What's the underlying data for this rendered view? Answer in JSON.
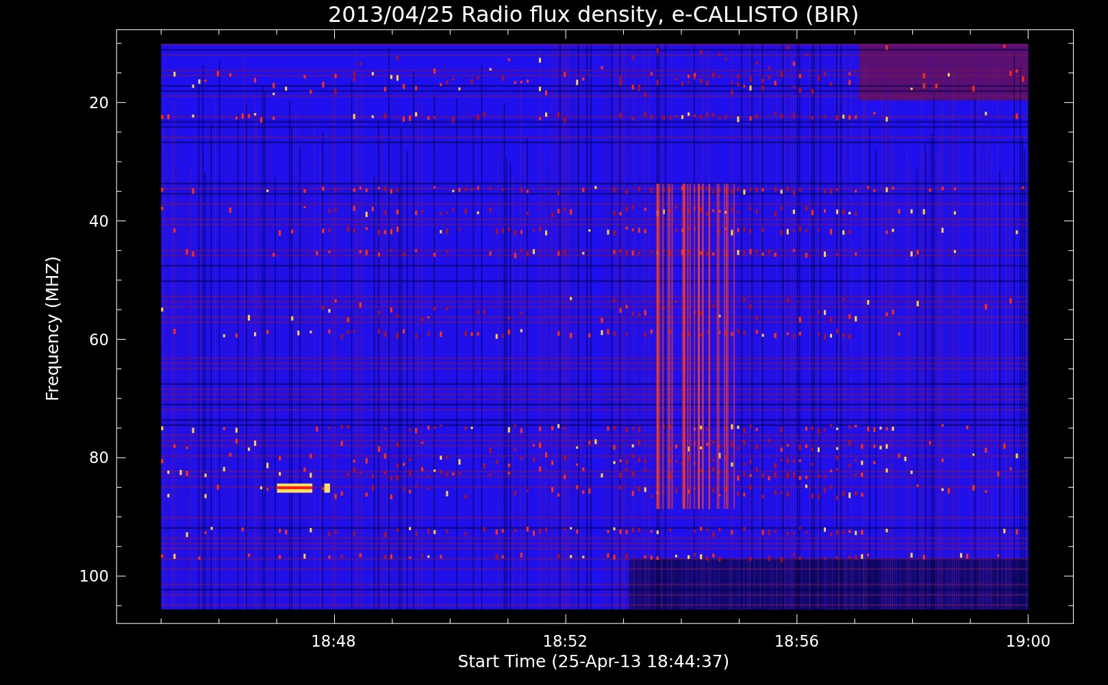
{
  "title": "2013/04/25  Radio flux density, e-CALLISTO (BIR)",
  "y_axis": {
    "label": "Frequency (MHZ)",
    "ticks": [
      "20",
      "40",
      "60",
      "80",
      "100"
    ]
  },
  "x_axis": {
    "label": "Start Time (25-Apr-13 18:44:37)",
    "ticks": [
      "18:48",
      "18:52",
      "18:56",
      "19:00"
    ]
  }
}
